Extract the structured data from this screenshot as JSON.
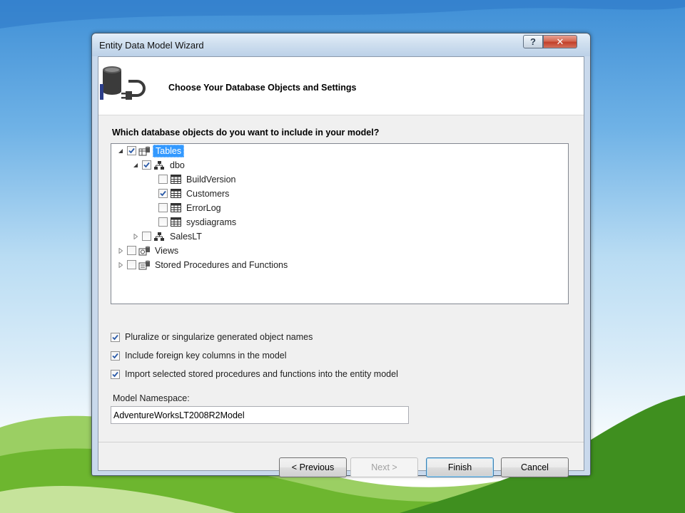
{
  "window": {
    "title": "Entity Data Model Wizard",
    "help_label": "?",
    "close_label": "✕"
  },
  "header": {
    "title": "Choose Your Database Objects and Settings",
    "icon": "database-plug-icon"
  },
  "question": "Which database objects do you want to include in your model?",
  "tree": [
    {
      "label": "Tables",
      "checked": true,
      "expanded": true,
      "selected": true,
      "icon": "tables-icon"
    },
    {
      "label": "dbo",
      "checked": true,
      "expanded": true,
      "icon": "schema-icon"
    },
    {
      "label": "BuildVersion",
      "checked": false,
      "icon": "table-icon"
    },
    {
      "label": "Customers",
      "checked": true,
      "icon": "table-icon"
    },
    {
      "label": "ErrorLog",
      "checked": false,
      "icon": "table-icon"
    },
    {
      "label": "sysdiagrams",
      "checked": false,
      "icon": "table-icon"
    },
    {
      "label": "SalesLT",
      "checked": false,
      "expanded": false,
      "icon": "schema-icon"
    },
    {
      "label": "Views",
      "checked": false,
      "expanded": false,
      "icon": "views-icon"
    },
    {
      "label": "Stored Procedures and Functions",
      "checked": false,
      "expanded": false,
      "icon": "procedures-icon"
    }
  ],
  "options": [
    {
      "label": "Pluralize or singularize generated object names",
      "checked": true
    },
    {
      "label": "Include foreign key columns in the model",
      "checked": true
    },
    {
      "label": "Import selected stored procedures and functions into the entity model",
      "checked": true
    }
  ],
  "namespace": {
    "label": "Model Namespace:",
    "value": "AdventureWorksLT2008R2Model"
  },
  "buttons": {
    "previous": "< Previous",
    "next": "Next >",
    "finish": "Finish",
    "cancel": "Cancel"
  },
  "colors": {
    "selection": "#3399ff",
    "close_button": "#c2402a",
    "title_bar": "#cfdfef"
  }
}
